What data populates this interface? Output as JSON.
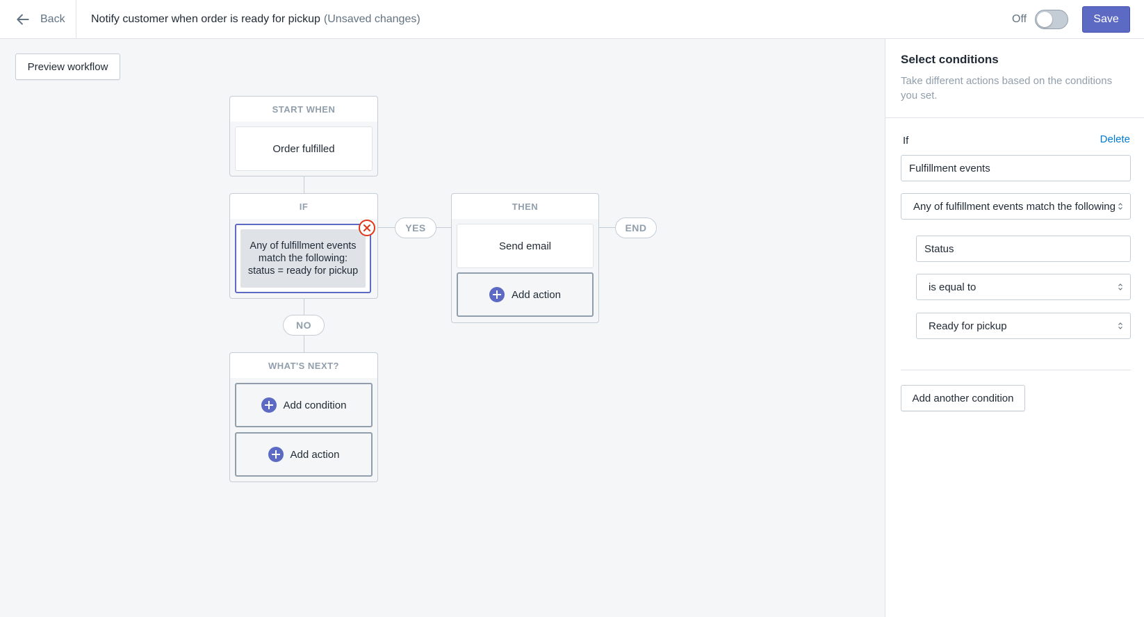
{
  "header": {
    "back_label": "Back",
    "title": "Notify customer when order is ready for pickup",
    "status_note": "(Unsaved changes)",
    "toggle_label": "Off",
    "toggle_on": false,
    "save_label": "Save"
  },
  "canvas": {
    "preview_label": "Preview workflow",
    "start": {
      "heading": "START WHEN",
      "trigger": "Order fulfilled"
    },
    "condition": {
      "heading": "IF",
      "text": "Any of fulfillment events match the following: status = ready for pickup"
    },
    "yes_label": "YES",
    "no_label": "NO",
    "end_label": "END",
    "then": {
      "heading": "THEN",
      "action": "Send email",
      "add_action_label": "Add action"
    },
    "next": {
      "heading": "WHAT'S NEXT?",
      "add_condition_label": "Add condition",
      "add_action_label": "Add action"
    }
  },
  "panel": {
    "title": "Select conditions",
    "subtitle": "Take different actions based on the conditions you set.",
    "if_label": "If",
    "delete_label": "Delete",
    "event_field": "Fulfillment events",
    "match_select": "Any of fulfillment events match the following",
    "property_field": "Status",
    "operator_select": "is equal to",
    "value_select": "Ready for pickup",
    "add_condition_label": "Add another condition"
  },
  "colors": {
    "primary": "#5c6ac4",
    "link": "#007ace",
    "error": "#de3618"
  }
}
